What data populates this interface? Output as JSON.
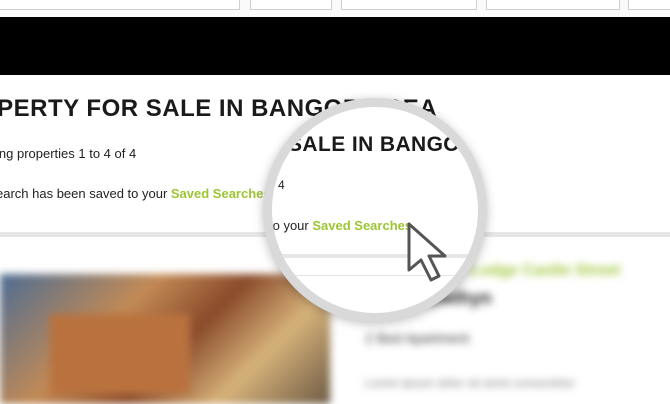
{
  "page": {
    "heading": "OPERTY FOR SALE IN BANGOR AREA",
    "showing_text": "ing properties 1 to 4 of 4",
    "saved_message_prefix": "earch has been saved to your ",
    "saved_link": "Saved Searches"
  },
  "magnifier": {
    "heading": "SALE IN BANGO",
    "count_fragment": "4",
    "saved_prefix": "to your ",
    "saved_link": "Saved Searches"
  },
  "listing": {
    "title": "Lodge Castle Street",
    "subtitle": "Y Bwthyn",
    "type": "2 Bed Apartment",
    "description": "Lorem ipsum dolor sit amet consectetur"
  },
  "colors": {
    "link": "#9dc534",
    "navbar": "#000000"
  }
}
